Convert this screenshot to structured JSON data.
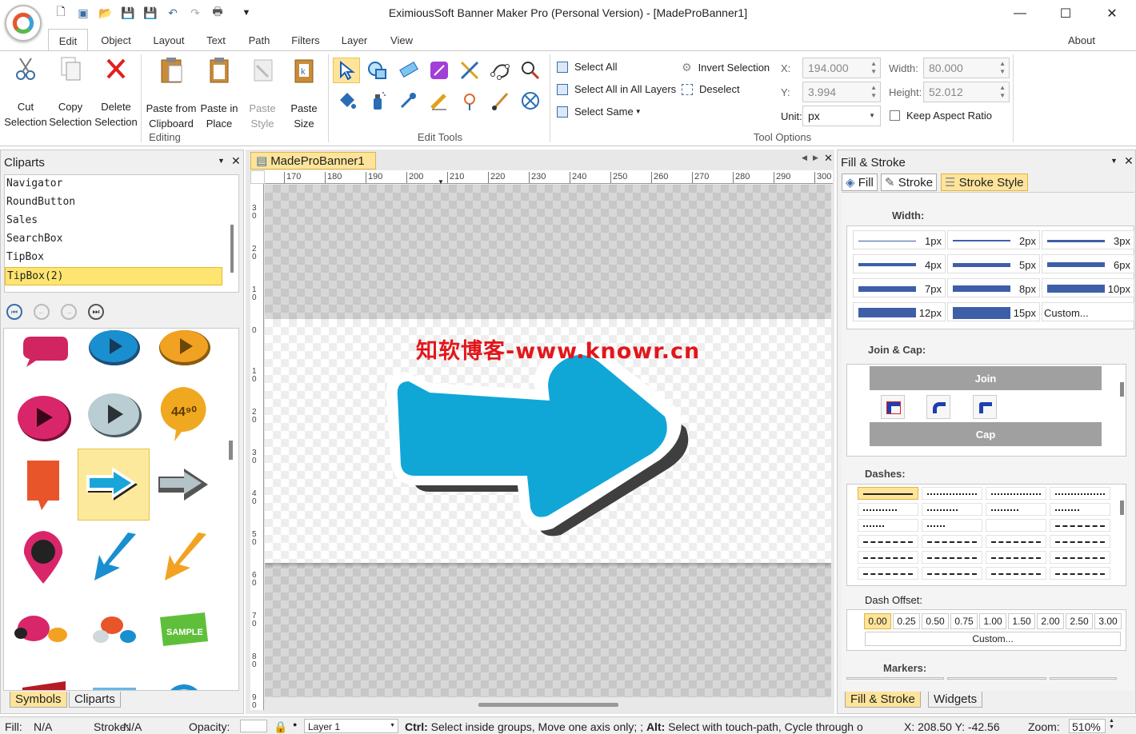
{
  "title": "EximiousSoft Banner Maker Pro (Personal Version) - [MadeProBanner1]",
  "about": "About",
  "menu_tabs": [
    "Edit",
    "Object",
    "Layout",
    "Text",
    "Path",
    "Filters",
    "Layer",
    "View"
  ],
  "ribbon": {
    "editing": {
      "label": "Editing",
      "cut": "Cut Selection",
      "copy": "Copy Selection",
      "delete": "Delete Selection",
      "paste_clip": "Paste from Clipboard",
      "paste_place": "Paste in Place",
      "paste_style": "Paste Style",
      "paste_size": "Paste Size"
    },
    "edit_tools_label": "Edit Tools",
    "select": {
      "select_all": "Select All",
      "select_all_layers": "Select All in All Layers",
      "select_same": "Select Same",
      "invert": "Invert Selection",
      "deselect": "Deselect"
    },
    "tool_options": {
      "label": "Tool Options",
      "x_label": "X:",
      "x": "194.000",
      "y_label": "Y:",
      "y": "3.994",
      "w_label": "Width:",
      "w": "80.000",
      "h_label": "Height:",
      "h": "52.012",
      "unit_label": "Unit:",
      "unit": "px",
      "keep_aspect": "Keep Aspect Ratio"
    }
  },
  "left_panel": {
    "title": "Cliparts",
    "items": [
      "Navigator",
      "RoundButton",
      "Sales",
      "SearchBox",
      "TipBox",
      "TipBox(2)"
    ],
    "bottom_tabs": [
      "Symbols",
      "Cliparts"
    ]
  },
  "document": {
    "tab": "MadeProBanner1",
    "ruler_marks": [
      "170",
      "180",
      "190",
      "200",
      "210",
      "220",
      "230",
      "240",
      "250",
      "260",
      "270",
      "280",
      "290",
      "300"
    ],
    "ruler_left": [
      "3 0",
      "2 0",
      "1 0",
      "0",
      "1 0",
      "2 0",
      "3 0",
      "4 0",
      "5 0",
      "6 0",
      "7 0",
      "8 0",
      "9 0"
    ],
    "watermark": "知软博客-www.knowr.cn"
  },
  "right_panel": {
    "title": "Fill & Stroke",
    "tabs": [
      "Fill",
      "Stroke",
      "Stroke Style"
    ],
    "width_label": "Width:",
    "widths": [
      "1px",
      "2px",
      "3px",
      "4px",
      "5px",
      "6px",
      "7px",
      "8px",
      "10px",
      "12px",
      "15px",
      "Custom..."
    ],
    "join_cap_label": "Join & Cap:",
    "join": "Join",
    "cap": "Cap",
    "dashes_label": "Dashes:",
    "dash_offset_label": "Dash Offset:",
    "offsets": [
      "0.00",
      "0.25",
      "0.50",
      "0.75",
      "1.00",
      "1.50",
      "2.00",
      "2.50",
      "3.00"
    ],
    "offset_custom": "Custom...",
    "markers_label": "Markers:",
    "bottom_tabs": [
      "Fill & Stroke",
      "Widgets"
    ]
  },
  "status": {
    "fill_label": "Fill:",
    "fill": "N/A",
    "stroke_label": "Stroke:",
    "stroke": "N/A",
    "opacity_label": "Opacity:",
    "layer": "Layer 1",
    "hint_ctrl": "Ctrl:",
    "hint_ctrl_text": " Select inside groups, Move one axis only; ;",
    "hint_alt": "Alt:",
    "hint_alt_text": " Select with touch-path, Cycle through o",
    "coords": "X: 208.50 Y: -42.56",
    "zoom_label": "Zoom:",
    "zoom": "510%"
  },
  "colors": {
    "accent": "#fde49a",
    "arrow": "#10a7d7",
    "watermark": "#e3161b",
    "stroke_line": "#3e5fa8"
  }
}
